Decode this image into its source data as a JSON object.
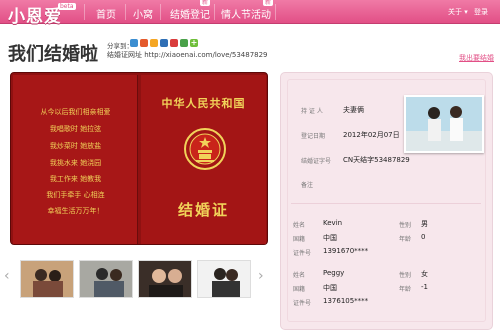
{
  "header": {
    "logo": "小恩爱",
    "beta": "beta",
    "nav": [
      {
        "label": "首页"
      },
      {
        "label": "小窝"
      },
      {
        "label": "结婚登记",
        "badge": "新"
      },
      {
        "label": "情人节活动",
        "badge": "新"
      }
    ],
    "about": "关于 ▾",
    "login": "登录"
  },
  "page": {
    "title": "我们结婚啦",
    "share_label": "分享到：",
    "url_label": "结婚证网址 http://xiaoenai.com/love/53487829",
    "exit_link": "我出要结婚"
  },
  "certificate": {
    "vows": [
      "从今以后我们相亲相爱",
      "我唱歌时 她拉弦",
      "我炒菜时 她放盐",
      "我挑水来 她浇园",
      "我工作来 她教我",
      "我们手牵手 心相连",
      "幸福生活万万年！"
    ],
    "country": "中华人民共和国",
    "title": "结婚证"
  },
  "details": {
    "witness_label": "持 证 人",
    "witness_value": "夫妻俩",
    "date_label": "登记日期",
    "date_value": "2012年02月07日",
    "cert_label": "结婚证字号",
    "cert_value": "CN天结字53487829",
    "note_label": "备注",
    "person1": {
      "name_label": "姓名",
      "name": "Kevin",
      "gender_label": "性别",
      "gender": "男",
      "country_label": "国籍",
      "country": "中国",
      "age_label": "年龄",
      "age": "0",
      "id_label": "证件号",
      "id": "1391670****"
    },
    "person2": {
      "name_label": "姓名",
      "name": "Peggy",
      "gender_label": "性别",
      "gender": "女",
      "country_label": "国籍",
      "country": "中国",
      "age_label": "年龄",
      "age": "-1",
      "id_label": "证件号",
      "id": "1376105****"
    }
  },
  "colors": {
    "brand": "#e24f86",
    "book": "#a71717",
    "gold": "#f1d35a",
    "card": "#f7e7ec"
  },
  "icons": [
    "share-icon-1",
    "share-icon-2",
    "share-icon-3",
    "share-icon-4",
    "share-icon-5",
    "share-icon-6",
    "share-icon-7"
  ]
}
